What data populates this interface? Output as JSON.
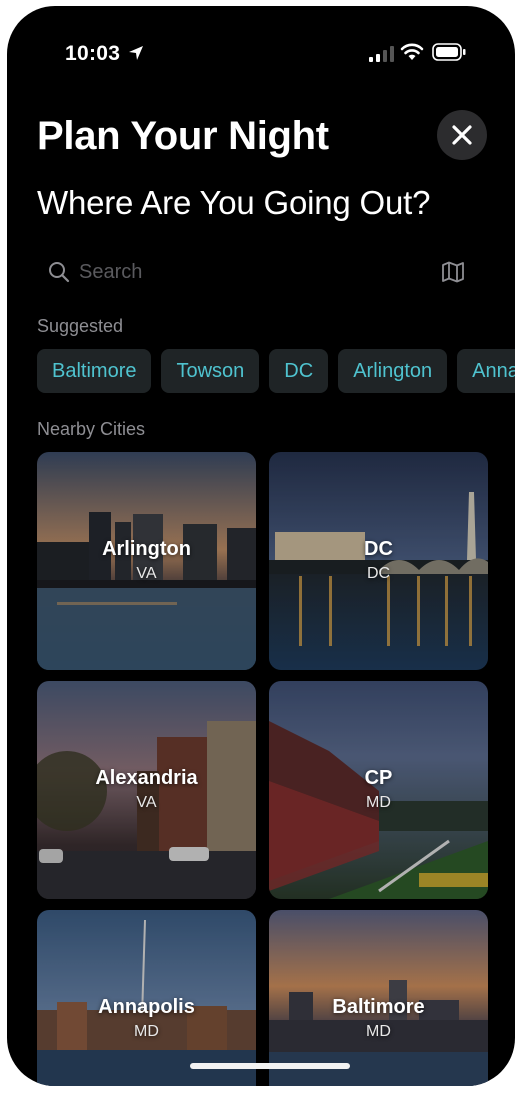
{
  "status": {
    "time": "10:03"
  },
  "header": {
    "title": "Plan Your Night",
    "subtitle": "Where Are You Going Out?"
  },
  "search": {
    "placeholder": "Search"
  },
  "suggested": {
    "label": "Suggested",
    "chips": [
      "Baltimore",
      "Towson",
      "DC",
      "Arlington",
      "Annapolis"
    ]
  },
  "nearby": {
    "label": "Nearby Cities",
    "cities": [
      {
        "name": "Arlington",
        "state": "VA"
      },
      {
        "name": "DC",
        "state": "DC"
      },
      {
        "name": "Alexandria",
        "state": "VA"
      },
      {
        "name": "CP",
        "state": "MD"
      },
      {
        "name": "Annapolis",
        "state": "MD"
      },
      {
        "name": "Baltimore",
        "state": "MD"
      }
    ]
  },
  "colors": {
    "accent": "#4fc3cf",
    "chip_bg": "#1f2426",
    "background": "#000000"
  }
}
